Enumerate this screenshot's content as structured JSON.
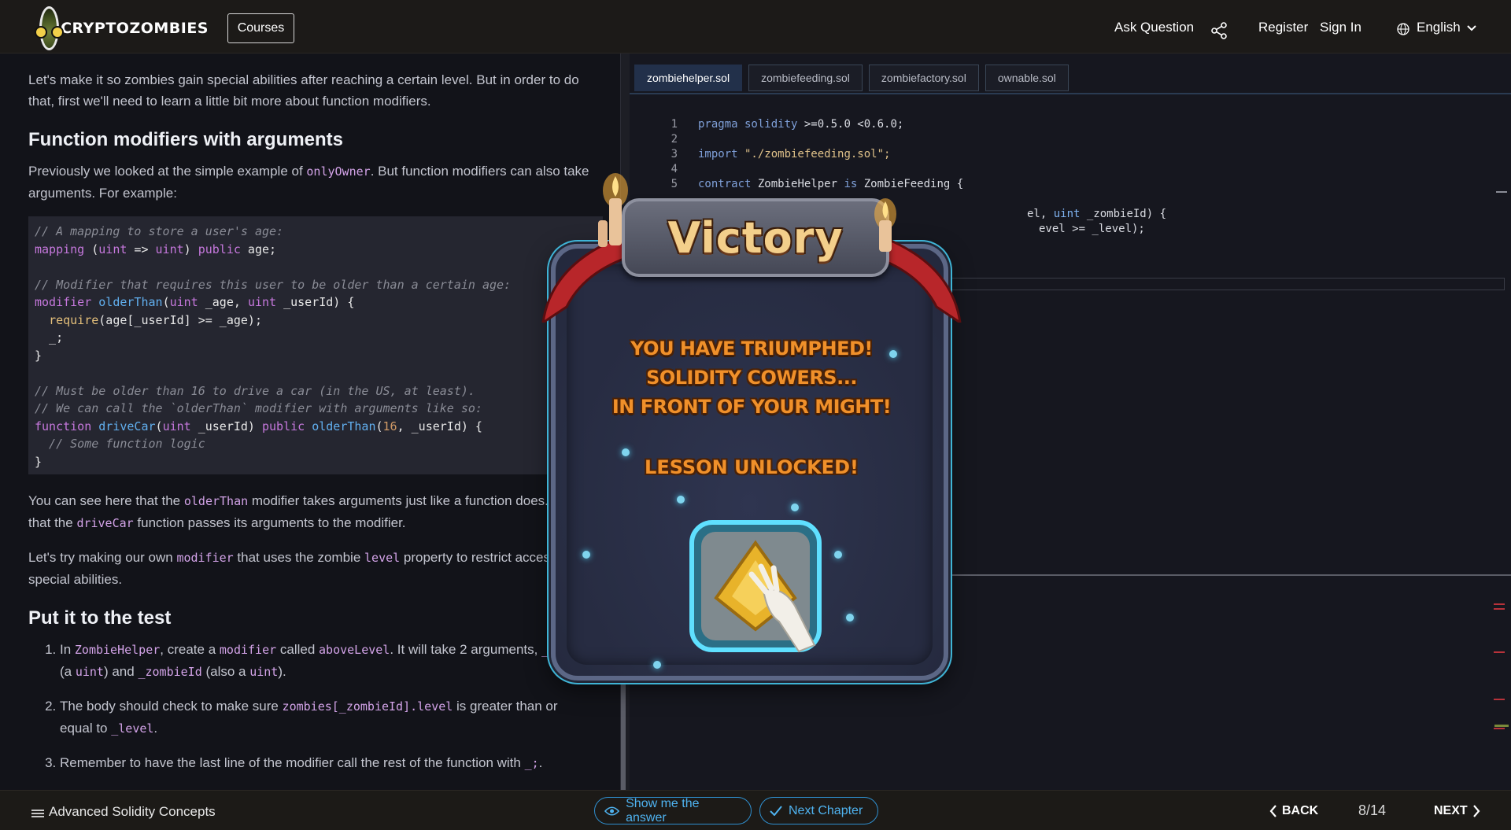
{
  "header": {
    "logo_text": "CRYPTOZOMBIES",
    "courses_label": "Courses",
    "ask_question": "Ask Question",
    "register": "Register",
    "sign_in": "Sign In",
    "language": "English"
  },
  "lesson": {
    "intro": "Let's make it so zombies gain special abilities after reaching a certain level. But in order to do that, first we'll need to learn a little bit more about function modifiers.",
    "heading1": "Function modifiers with arguments",
    "p1_before": "Previously we looked at the simple example of ",
    "p1_code": "onlyOwner",
    "p1_after": ". But function modifiers can also take arguments. For example:",
    "code": {
      "l1": "// A mapping to store a user's age:",
      "l2_kw": "mapping",
      "l2_a": " (",
      "l2_t1": "uint",
      "l2_b": " => ",
      "l2_t2": "uint",
      "l2_c": ") ",
      "l2_kw2": "public",
      "l2_d": " age;",
      "l4": "// Modifier that requires this user to be older than a certain age:",
      "l5_kw": "modifier",
      "l5_fn": "olderThan",
      "l5_a": "(",
      "l5_t1": "uint",
      "l5_b": " _age, ",
      "l5_t2": "uint",
      "l5_c": " _userId) {",
      "l6_rq": "require",
      "l6_a": "(age[_userId] >= _age);",
      "l7": "  _;",
      "l8": "}",
      "l10": "// Must be older than 16 to drive a car (in the US, at least).",
      "l11": "// We can call the `olderThan` modifier with arguments like so:",
      "l12_kw": "function",
      "l12_fn": "driveCar",
      "l12_a": "(",
      "l12_t1": "uint",
      "l12_b": " _userId) ",
      "l12_kw2": "public",
      "l12_fn2": "olderThan",
      "l12_c": "(",
      "l12_num": "16",
      "l12_d": ", _userId) {",
      "l13": "  // Some function logic",
      "l14": "}"
    },
    "p2_a": "You can see here that the ",
    "p2_code1": "olderThan",
    "p2_b": " modifier takes arguments just like a function does. And that the ",
    "p2_code2": "driveCar",
    "p2_c": " function passes its arguments to the modifier.",
    "p3_a": "Let's try making our own ",
    "p3_code1": "modifier",
    "p3_b": " that uses the zombie ",
    "p3_code2": "level",
    "p3_c": " property to restrict access to special abilities.",
    "heading2": "Put it to the test",
    "li1_a": "In ",
    "li1_c1": "ZombieHelper",
    "li1_b": ", create a ",
    "li1_c2": "modifier",
    "li1_c": " called ",
    "li1_c3": "aboveLevel",
    "li1_d": ". It will take 2 arguments, ",
    "li1_c4": "_level",
    "li1_e": " (a ",
    "li1_c5": "uint",
    "li1_f": ") and ",
    "li1_c6": "_zombieId",
    "li1_g": " (also a ",
    "li1_c7": "uint",
    "li1_h": ").",
    "li2_a": "The body should check to make sure ",
    "li2_c1": "zombies[_zombieId].level",
    "li2_b": " is greater than or equal to ",
    "li2_c2": "_level",
    "li2_c": ".",
    "li3_a": "Remember to have the last line of the modifier call the rest of the function with ",
    "li3_c1": "_;",
    "li3_b": "."
  },
  "editor": {
    "tabs": [
      "zombiehelper.sol",
      "zombiefeeding.sol",
      "zombiefactory.sol",
      "ownable.sol"
    ],
    "line1_kw": "pragma solidity",
    "line1_rest": " >=0.5.0 <0.6.0;",
    "line3_kw": "import",
    "line3_str": " \"./zombiefeeding.sol\";",
    "line5_kw": "contract",
    "line5_name": " ZombieHelper ",
    "line5_is": "is",
    "line5_rest": " ZombieFeeding {",
    "line7_a": "el, ",
    "line7_t": "uint",
    "line7_b": " _zombieId) {",
    "line8": "evel >= _level);",
    "line_numbers": [
      "1",
      "2",
      "3",
      "4",
      "5"
    ]
  },
  "modal": {
    "title": "Victory",
    "msg1": "YOU HAVE TRIUMPHED!",
    "msg2": "SOLIDITY COWERS...",
    "msg3": "IN FRONT OF YOUR MIGHT!",
    "unlocked": "LESSON UNLOCKED!"
  },
  "footer": {
    "course": "Advanced Solidity Concepts",
    "show_answer": "Show me the answer",
    "next_chapter": "Next Chapter",
    "back": "BACK",
    "progress": "8/14",
    "next": "NEXT"
  },
  "colors": {
    "accent_blue": "#2f8fcf",
    "orange_text": "#f0902a",
    "victory_gold": "#f3cf8b"
  }
}
